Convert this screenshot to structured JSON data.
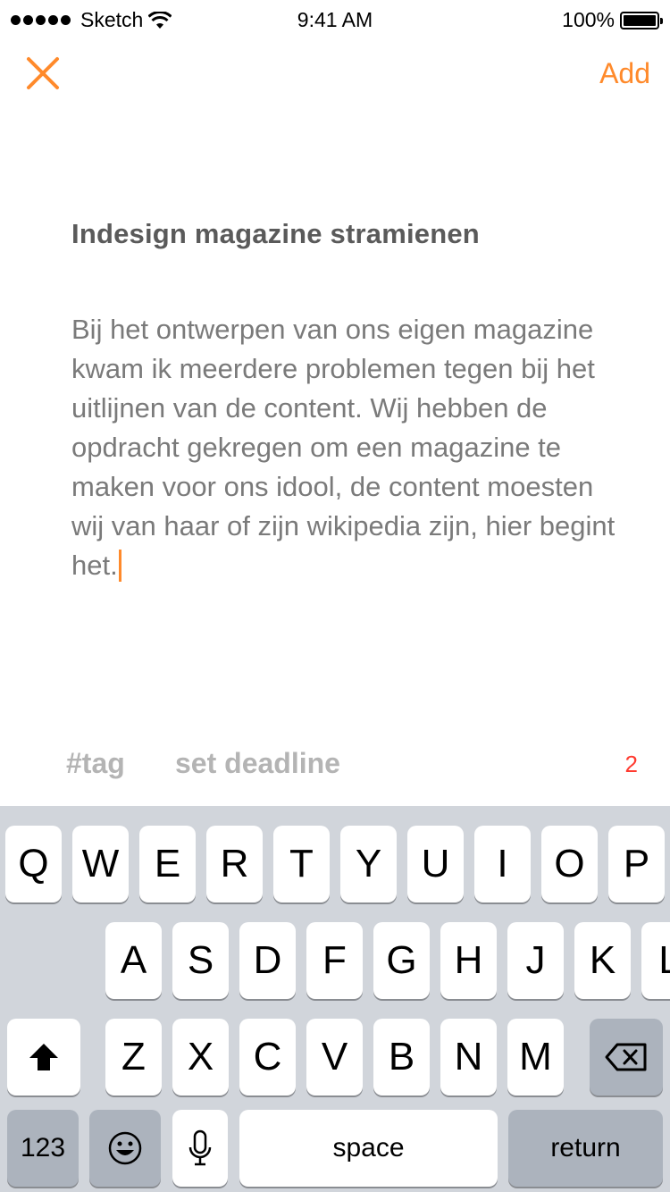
{
  "status_bar": {
    "carrier": "Sketch",
    "time": "9:41 AM",
    "battery_percent": "100%",
    "battery_level": 1.0,
    "signal_icon": "signal-dots-icon",
    "wifi_icon": "wifi-icon"
  },
  "nav": {
    "close_icon": "close-icon",
    "add_label": "Add"
  },
  "note": {
    "title": "Indesign magazine stramienen",
    "body": "Bij het ontwerpen van ons eigen magazine kwam ik meerdere problemen tegen bij het uitlijnen van de content. Wij hebben de opdracht gekregen om een magazine te maken voor ons idool, de content moesten wij van haar of zijn wikipedia zijn, hier begint het."
  },
  "toolbar": {
    "tag_label": "#tag",
    "deadline_label": "set deadline",
    "count": "2"
  },
  "keyboard": {
    "row1": [
      "Q",
      "W",
      "E",
      "R",
      "T",
      "Y",
      "U",
      "I",
      "O",
      "P"
    ],
    "row2": [
      "A",
      "S",
      "D",
      "F",
      "G",
      "H",
      "J",
      "K",
      "L"
    ],
    "row3": [
      "Z",
      "X",
      "C",
      "V",
      "B",
      "N",
      "M"
    ],
    "numbers_label": "123",
    "space_label": "space",
    "return_label": "return",
    "shift_icon": "shift-icon",
    "delete_icon": "delete-icon",
    "emoji_icon": "emoji-icon",
    "mic_icon": "microphone-icon"
  },
  "colors": {
    "accent": "#FF8A2B",
    "count": "#FF3B30",
    "keyboard_bg": "#D1D5DB",
    "key_dark": "#ACB3BD"
  }
}
